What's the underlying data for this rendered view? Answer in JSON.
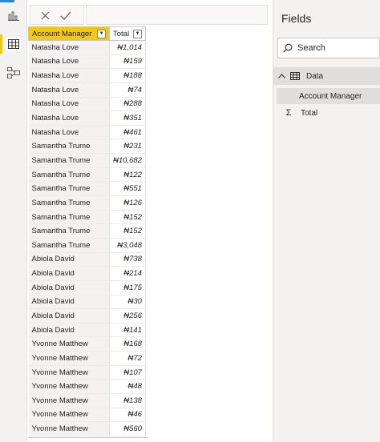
{
  "formula_bar": {
    "value": ""
  },
  "table": {
    "columns": [
      {
        "label": "Account Manager"
      },
      {
        "label": "Total"
      }
    ],
    "rows": [
      {
        "manager": "Natasha Love",
        "total": "₦1,014"
      },
      {
        "manager": "Natasha Love",
        "total": "₦159"
      },
      {
        "manager": "Natasha Love",
        "total": "₦188"
      },
      {
        "manager": "Natasha Love",
        "total": "₦74"
      },
      {
        "manager": "Natasha Love",
        "total": "₦288"
      },
      {
        "manager": "Natasha Love",
        "total": "₦351"
      },
      {
        "manager": "Natasha Love",
        "total": "₦461"
      },
      {
        "manager": "Samantha Trume",
        "total": "₦231"
      },
      {
        "manager": "Samantha Trume",
        "total": "₦10,682"
      },
      {
        "manager": "Samantha Trume",
        "total": "₦122"
      },
      {
        "manager": "Samantha Trume",
        "total": "₦551"
      },
      {
        "manager": "Samantha Trume",
        "total": "₦126"
      },
      {
        "manager": "Samantha Trume",
        "total": "₦152"
      },
      {
        "manager": "Samantha Trume",
        "total": "₦152"
      },
      {
        "manager": "Samantha Trume",
        "total": "₦3,048"
      },
      {
        "manager": "Abiola David",
        "total": "₦738"
      },
      {
        "manager": "Abiola David",
        "total": "₦214"
      },
      {
        "manager": "Abiola David",
        "total": "₦175"
      },
      {
        "manager": "Abiola David",
        "total": "₦30"
      },
      {
        "manager": "Abiola David",
        "total": "₦256"
      },
      {
        "manager": "Abiola David",
        "total": "₦141"
      },
      {
        "manager": "Yvonne Matthew",
        "total": "₦168"
      },
      {
        "manager": "Yvonne Matthew",
        "total": "₦72"
      },
      {
        "manager": "Yvonne Matthew",
        "total": "₦107"
      },
      {
        "manager": "Yvonne Matthew",
        "total": "₦48"
      },
      {
        "manager": "Yvonne Matthew",
        "total": "₦138"
      },
      {
        "manager": "Yvonne Matthew",
        "total": "₦46"
      },
      {
        "manager": "Yvonne Matthew",
        "total": "₦560"
      }
    ]
  },
  "fields_pane": {
    "title": "Fields",
    "search_placeholder": "Search",
    "table_name": "Data",
    "fields": [
      {
        "label": "Account Manager",
        "icon": "none",
        "selected": true
      },
      {
        "label": "Total",
        "icon": "sigma-icon",
        "selected": false
      }
    ]
  },
  "colors": {
    "accent_yellow": "#f2c811",
    "accent_blue": "#2b88d8",
    "pane_bg": "#f3f2f1"
  }
}
